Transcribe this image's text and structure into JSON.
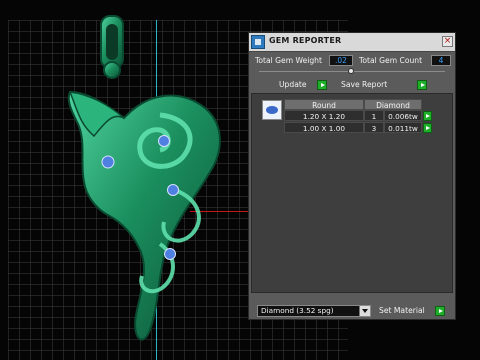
{
  "panel": {
    "title": "GEM REPORTER",
    "total_gem_weight_label": "Total Gem Weight",
    "total_gem_weight_value": ".02",
    "total_gem_count_label": "Total Gem Count",
    "total_gem_count_value": "4",
    "update_label": "Update",
    "save_report_label": "Save Report",
    "table": {
      "headers": [
        "Round",
        "Diamond"
      ],
      "rows": [
        {
          "size": "1.20 X 1.20",
          "count": "1",
          "weight": "0.006tw"
        },
        {
          "size": "1.00 X 1.00",
          "count": "3",
          "weight": "0.011tw"
        }
      ]
    },
    "material_select_value": "Diamond    (3.52 spg)",
    "set_material_label": "Set Material"
  },
  "colors": {
    "pendant": "#1b8f5e",
    "gem_marker": "#4f7fe0",
    "axis_x": "#c41818",
    "axis_y": "#2fb6c6"
  }
}
